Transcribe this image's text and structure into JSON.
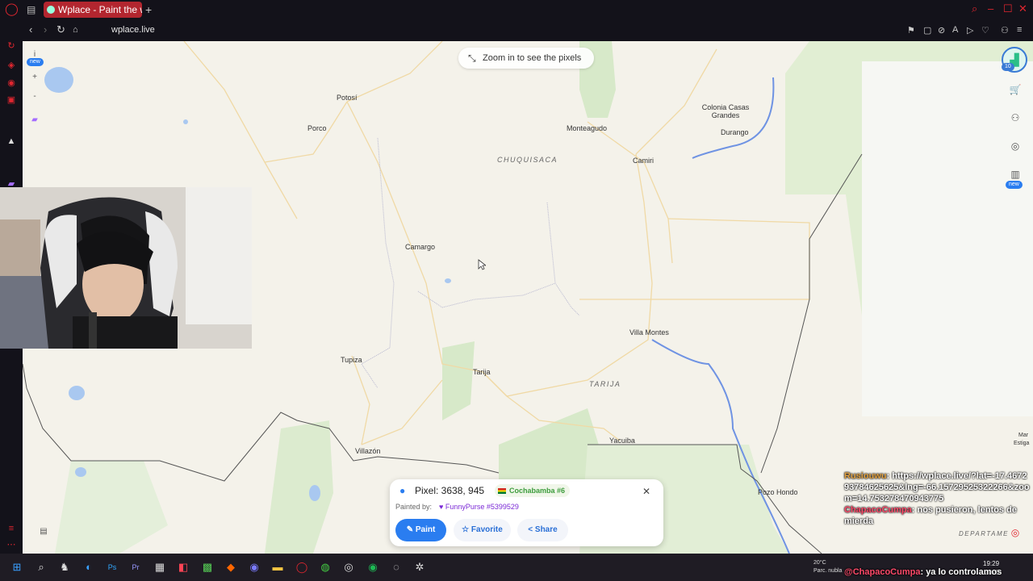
{
  "browser": {
    "tab_title": "Wplace - Paint the world",
    "url": "wplace.live"
  },
  "map": {
    "zoom_hint": "Zoom in to see the pixels",
    "sidebar_new_badge": "new",
    "stats_new_badge": "new",
    "avatar_count": "10",
    "places": {
      "potosi": "Potosí",
      "porco": "Porco",
      "monteagudo": "Monteagudo",
      "camiri": "Camiri",
      "colonia": "Colonia Casas Grandes",
      "durango": "Durango",
      "camargo": "Camargo",
      "villa_montes": "Villa Montes",
      "tupiza": "Tupiza",
      "tarija": "Tarija",
      "villazon": "Villazón",
      "yacuiba": "Yacuiba",
      "pozo_hondo": "Pozo Hondo",
      "mariscal": "Mar",
      "estigarribia": "Estiga"
    },
    "regions": {
      "chuquisaca": "CHUQUISACA",
      "tarija": "TARIJA",
      "departamento": "DEPARTAME"
    }
  },
  "pixel_popup": {
    "pixel_label": "Pixel: 3638, 945",
    "region_chip": "Cochabamba #6",
    "painted_by_label": "Painted by:",
    "painter": "FunnyPurse #5399529",
    "paint_button": "Paint",
    "favorite_button": "Favorite",
    "share_button": "Share"
  },
  "chat": {
    "user1": "Rusiouwu",
    "msg1": ": https://wplace.live/?lat=-17.467293784625625&lng=-66.15729525322266&zoom=14.753278470943775",
    "user2": "ChapacoCumpa",
    "msg2": ": nos pusieron, lentos de mierda",
    "user3": "@ChapacoCumpa",
    "msg3": ": ya lo controlamos"
  },
  "taskbar": {
    "weather_temp": "20°C",
    "weather_desc": "Parc. nubla",
    "time": "19:29",
    "date": "2025"
  },
  "colors": {
    "accent": "#2a7df0",
    "tab": "#b3262f",
    "opera": "#e0262f"
  }
}
